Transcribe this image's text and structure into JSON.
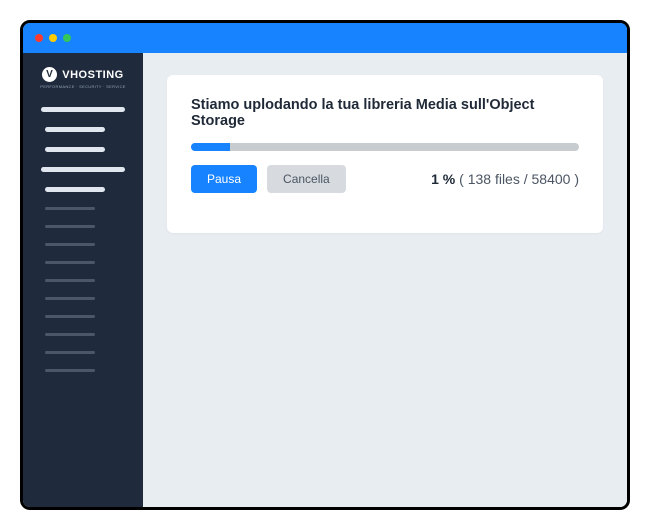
{
  "logo": {
    "mark": "V",
    "text": "VHOSTING",
    "sub": "PERFORMANCE · SECURITY · SERVICE"
  },
  "card": {
    "title": "Stiamo uplodando la tua libreria Media sull'Object Storage",
    "progress_percent": 10,
    "pause_label": "Pausa",
    "cancel_label": "Cancella",
    "status_percent": "1 %",
    "status_detail": "( 138 files / 58400 )"
  }
}
